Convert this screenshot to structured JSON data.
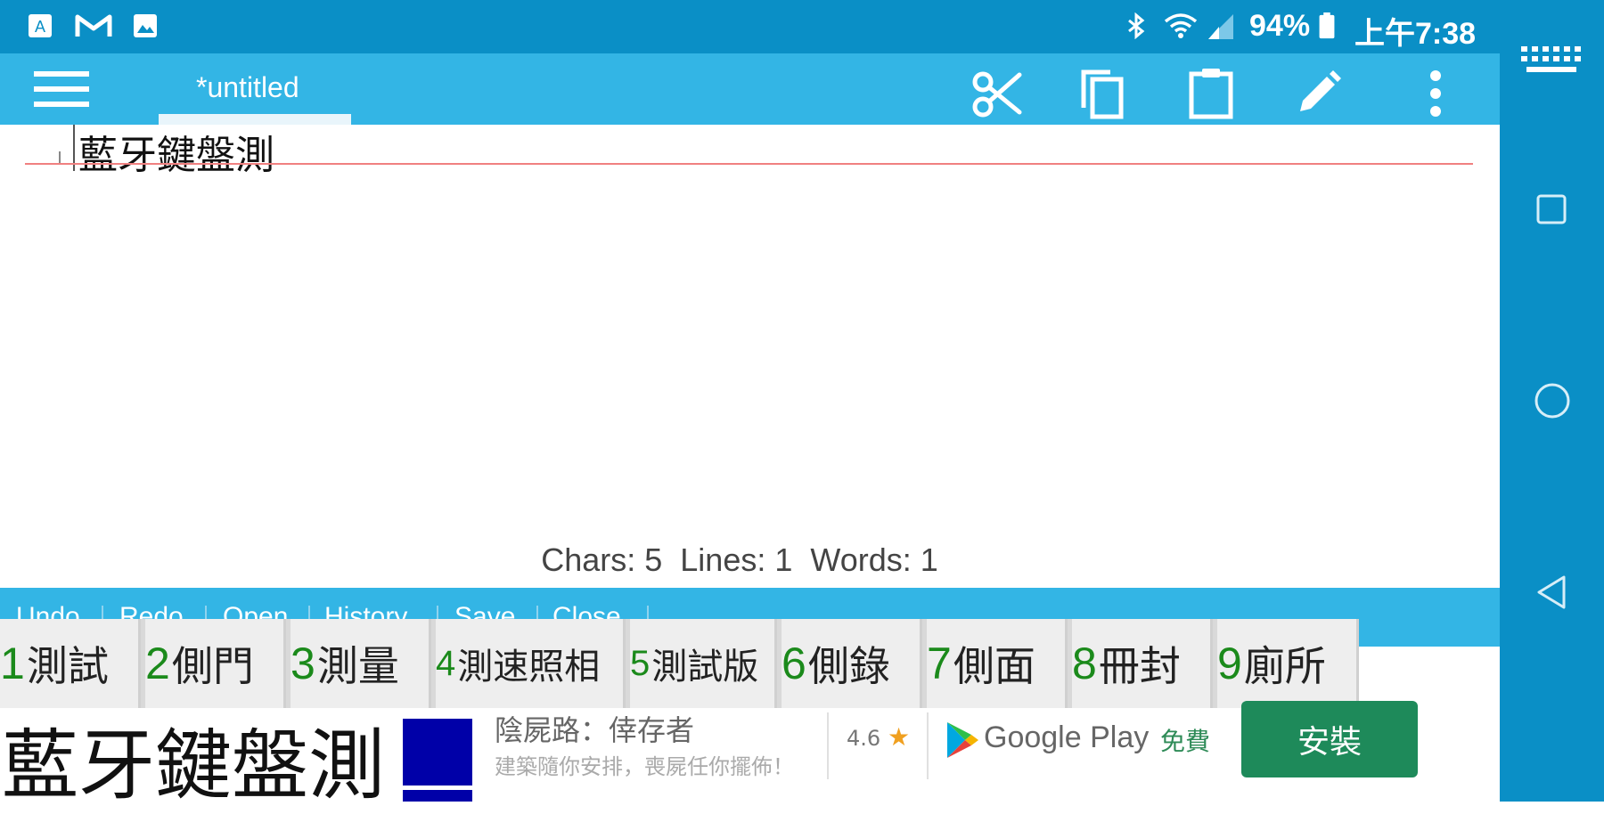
{
  "status_bar": {
    "battery": "94%",
    "time": "上午7:38",
    "icons": [
      "app-a-icon",
      "gmail-icon",
      "gallery-icon",
      "bluetooth-icon",
      "wifi-icon",
      "signal-icon",
      "battery-icon"
    ]
  },
  "toolbar": {
    "tab_title": "*untitled",
    "icons": [
      "menu-icon",
      "cut-icon",
      "copy-icon",
      "paste-icon",
      "edit-icon",
      "more-vert-icon"
    ]
  },
  "editor": {
    "text": "藍牙鍵盤測"
  },
  "stats": {
    "text": "Chars: 5  Lines: 1  Words: 1"
  },
  "bottom_bar": {
    "items": [
      "Undo",
      "Redo",
      "Open",
      "History",
      "Save",
      "Close"
    ]
  },
  "candidates": [
    {
      "num": "1",
      "word": "測試"
    },
    {
      "num": "2",
      "word": "側門"
    },
    {
      "num": "3",
      "word": "測量"
    },
    {
      "num": "4",
      "word": "測速照相"
    },
    {
      "num": "5",
      "word": "測試版"
    },
    {
      "num": "6",
      "word": "側錄"
    },
    {
      "num": "7",
      "word": "側面"
    },
    {
      "num": "8",
      "word": "冊封"
    },
    {
      "num": "9",
      "word": "廁所"
    }
  ],
  "ad": {
    "big_text": "藍牙鍵盤測",
    "title": "陰屍路：倖存者",
    "subtitle": "建築隨你安排，喪屍任你擺佈！",
    "rating": "4.6",
    "star": "★",
    "store": "Google Play",
    "free_label": "免費",
    "install_label": "安裝"
  },
  "nav": {
    "icons": [
      "keyboard-icon",
      "recents-icon",
      "home-icon",
      "back-icon"
    ]
  },
  "colors": {
    "status_bar": "#0a8fc6",
    "toolbar": "#33b5e5",
    "candidate_number": "#1b8a1b",
    "install_button": "#1e8a5a"
  }
}
